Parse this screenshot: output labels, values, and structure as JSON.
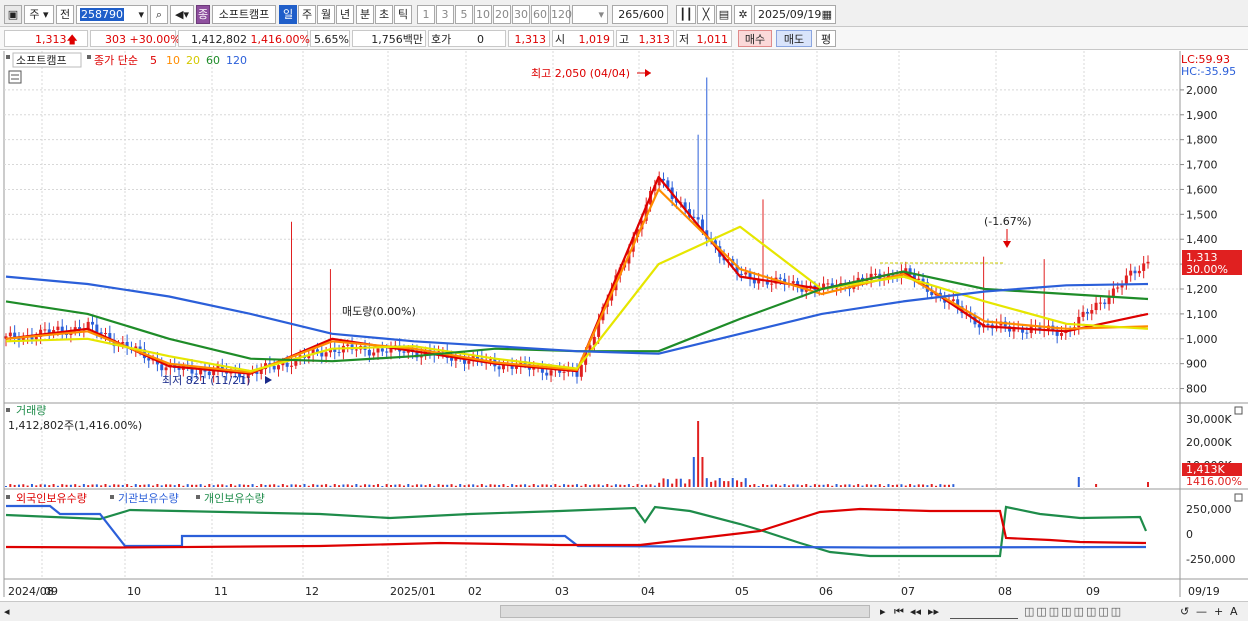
{
  "toolbar": {
    "view_menu": "주",
    "prev_label": "전",
    "stock_code": "258790",
    "theme_label": "종",
    "stock_name": "소프트캠프",
    "periods": [
      "일",
      "주",
      "월",
      "년",
      "분",
      "초",
      "틱"
    ],
    "active_period": "일",
    "intervals": [
      "1",
      "3",
      "5",
      "10",
      "20",
      "30",
      "60",
      "120"
    ],
    "count": "265",
    "count_total": "/600",
    "date": "2025/09/19"
  },
  "quote": {
    "price": "1,313",
    "change": "303",
    "change_pct": "+30.00%",
    "volume": "1,412,802",
    "volume_ratio": "1,416.00%",
    "turnover_rate": "5.65%",
    "amount": "1,756백만",
    "bid_ask_label": "호가",
    "bid_ask": "0",
    "current": "1,313",
    "open_label": "시",
    "open": "1,019",
    "high_label": "고",
    "high": "1,313",
    "low_label": "저",
    "low": "1,011",
    "buy_label": "매수",
    "sell_label": "매도",
    "avg_label": "평"
  },
  "legend": {
    "stock": "소프트캠프",
    "ma_label": "종가 단순",
    "ma_periods": [
      "5",
      "10",
      "20",
      "60",
      "120"
    ],
    "ma_colors": [
      "#dd0000",
      "#ff8c00",
      "#e6e600",
      "#1e8c28",
      "#2b5fd9"
    ]
  },
  "right_labels": {
    "lc": "LC:59.93",
    "hc": "HC:-35.95"
  },
  "price_axis": [
    "2,000",
    "1,900",
    "1,800",
    "1,700",
    "1,600",
    "1,500",
    "1,400",
    "1,300",
    "1,200",
    "1,100",
    "1,000",
    "900",
    "800"
  ],
  "price_badge": {
    "value": "1,313",
    "pct": "30.00%"
  },
  "annotations": {
    "high": "최고 2,050 (04/04)",
    "low": "최저 821 (11/21)",
    "mid": "매도량(0.00%)",
    "recent": "(-1.67%)"
  },
  "volume_panel": {
    "title": "거래량",
    "value": "1,412,802주(1,416.00%)",
    "axis": [
      "30,000K",
      "20,000K",
      "10,000K"
    ],
    "badge": "1,413K",
    "badge2": "1416.00%"
  },
  "holding_panel": {
    "series": [
      "외국인보유수량",
      "기관보유수량",
      "개인보유수량"
    ],
    "colors": [
      "#dd0000",
      "#2b5fd9",
      "#1e8c4a"
    ],
    "axis": [
      "250,000",
      "0",
      "-250,000"
    ]
  },
  "x_axis": [
    "2024/08",
    "09",
    "10",
    "11",
    "12",
    "2025/01",
    "02",
    "03",
    "04",
    "05",
    "06",
    "07",
    "08",
    "09",
    "09/19"
  ],
  "chart_data": {
    "type": "candlestick",
    "x": [
      "2024/08",
      "2024/09",
      "2024/10",
      "2024/11",
      "2024/12",
      "2025/01",
      "2025/02",
      "2025/03",
      "2025/04",
      "2025/05",
      "2025/06",
      "2025/07",
      "2025/08",
      "2025/09",
      "2025/09/19"
    ],
    "close": [
      1000,
      1050,
      880,
      860,
      960,
      950,
      900,
      860,
      1650,
      1250,
      1200,
      1270,
      1050,
      1030,
      1313
    ],
    "ma_series": [
      {
        "name": "5",
        "values": [
          1000,
          1040,
          890,
          860,
          1000,
          950,
          900,
          870,
          1650,
          1250,
          1200,
          1270,
          1050,
          1030,
          1100
        ]
      },
      {
        "name": "10",
        "values": [
          1000,
          1030,
          900,
          865,
          990,
          960,
          905,
          875,
          1600,
          1280,
          1180,
          1260,
          1070,
          1040,
          1050
        ]
      },
      {
        "name": "20",
        "values": [
          990,
          1000,
          930,
          870,
          960,
          970,
          920,
          880,
          1300,
          1450,
          1200,
          1250,
          1150,
          1060,
          1040
        ]
      },
      {
        "name": "60",
        "values": [
          1150,
          1100,
          1000,
          920,
          910,
          930,
          960,
          950,
          950,
          1080,
          1200,
          1270,
          1200,
          1180,
          1160
        ]
      },
      {
        "name": "120",
        "values": [
          1250,
          1220,
          1170,
          1100,
          1020,
          990,
          970,
          950,
          940,
          1020,
          1100,
          1150,
          1190,
          1215,
          1220
        ]
      }
    ],
    "high": {
      "value": 2050,
      "date": "04/04"
    },
    "low": {
      "value": 821,
      "date": "11/21"
    },
    "ylim": [
      750,
      2100
    ]
  }
}
